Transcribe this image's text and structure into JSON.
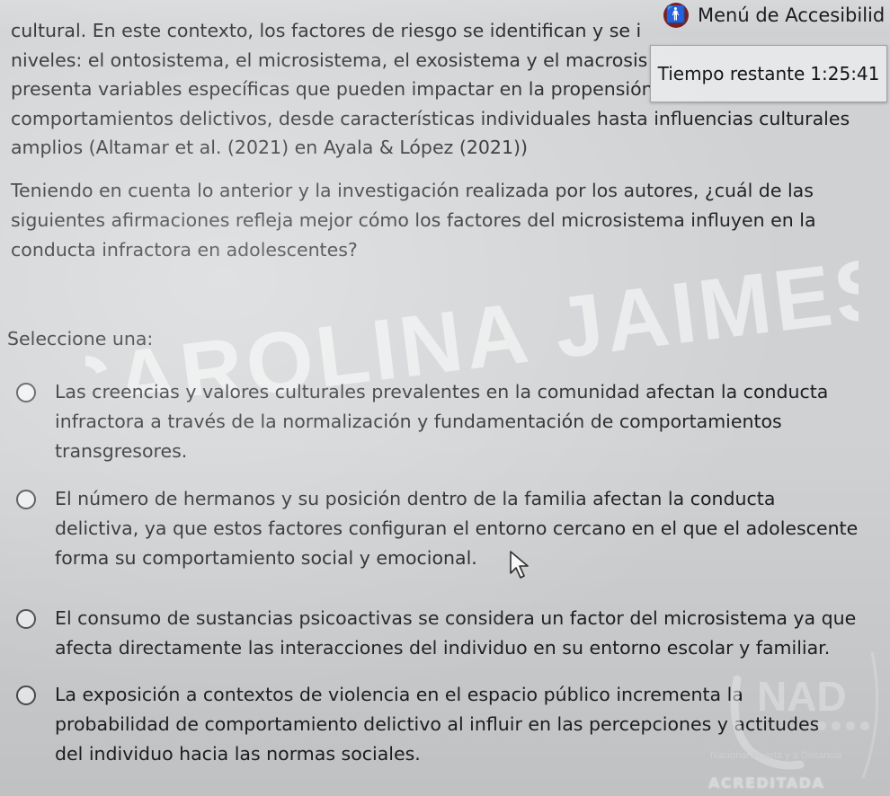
{
  "header": {
    "accessibility_menu": "Menú de Accesibilid",
    "accessibility_icon": "accessibility-person-icon",
    "timer_label": "Tiempo restante",
    "timer_value": "1:25:41"
  },
  "context_lines": [
    "cultural. En este contexto, los factores de riesgo se identifican y se i",
    "niveles: el ontosistema, el microsistema, el exosistema y el macrosis",
    "presenta variables específicas que pueden impactar en la propensión hacia",
    "comportamientos delictivos, desde características individuales hasta influencias culturales",
    "amplios (Altamar et al. (2021) en Ayala & López (2021))"
  ],
  "question_lines": [
    "Teniendo en cuenta lo anterior y la investigación realizada por los autores, ¿cuál de las",
    "siguientes afirmaciones refleja mejor cómo los factores del microsistema influyen en la",
    "conducta infractora en adolescentes?"
  ],
  "select_label": "Seleccione una:",
  "watermark": "CAROLINA JAIMES",
  "options": [
    {
      "lines": [
        "Las creencias y valores culturales prevalentes en la comunidad afectan la conducta",
        "infractora a través de la normalización y fundamentación de comportamientos",
        "transgresores."
      ]
    },
    {
      "lines": [
        "El número de hermanos y su posición dentro de la familia afectan la conducta",
        "delictiva, ya que estos factores configuran el entorno cercano en el que el adolescente",
        "forma su comportamiento social y emocional."
      ]
    },
    {
      "lines": [
        "El consumo de sustancias psicoactivas se considera un factor del microsistema ya que",
        "afecta directamente las interacciones del individuo en su entorno escolar y familiar."
      ]
    },
    {
      "lines": [
        "La exposición a contextos de violencia en el espacio público incrementa la",
        "probabilidad de comportamiento delictivo al influir en las percepciones y actitudes",
        "del individuo hacia las normas sociales."
      ]
    }
  ],
  "logo": {
    "text": "NAD",
    "subtitle": "Nacional Abierta y a Distancia",
    "badge": "ACREDITADA"
  },
  "colors": {
    "accent": "#7a1f1f",
    "background": "#cfd1d3"
  }
}
